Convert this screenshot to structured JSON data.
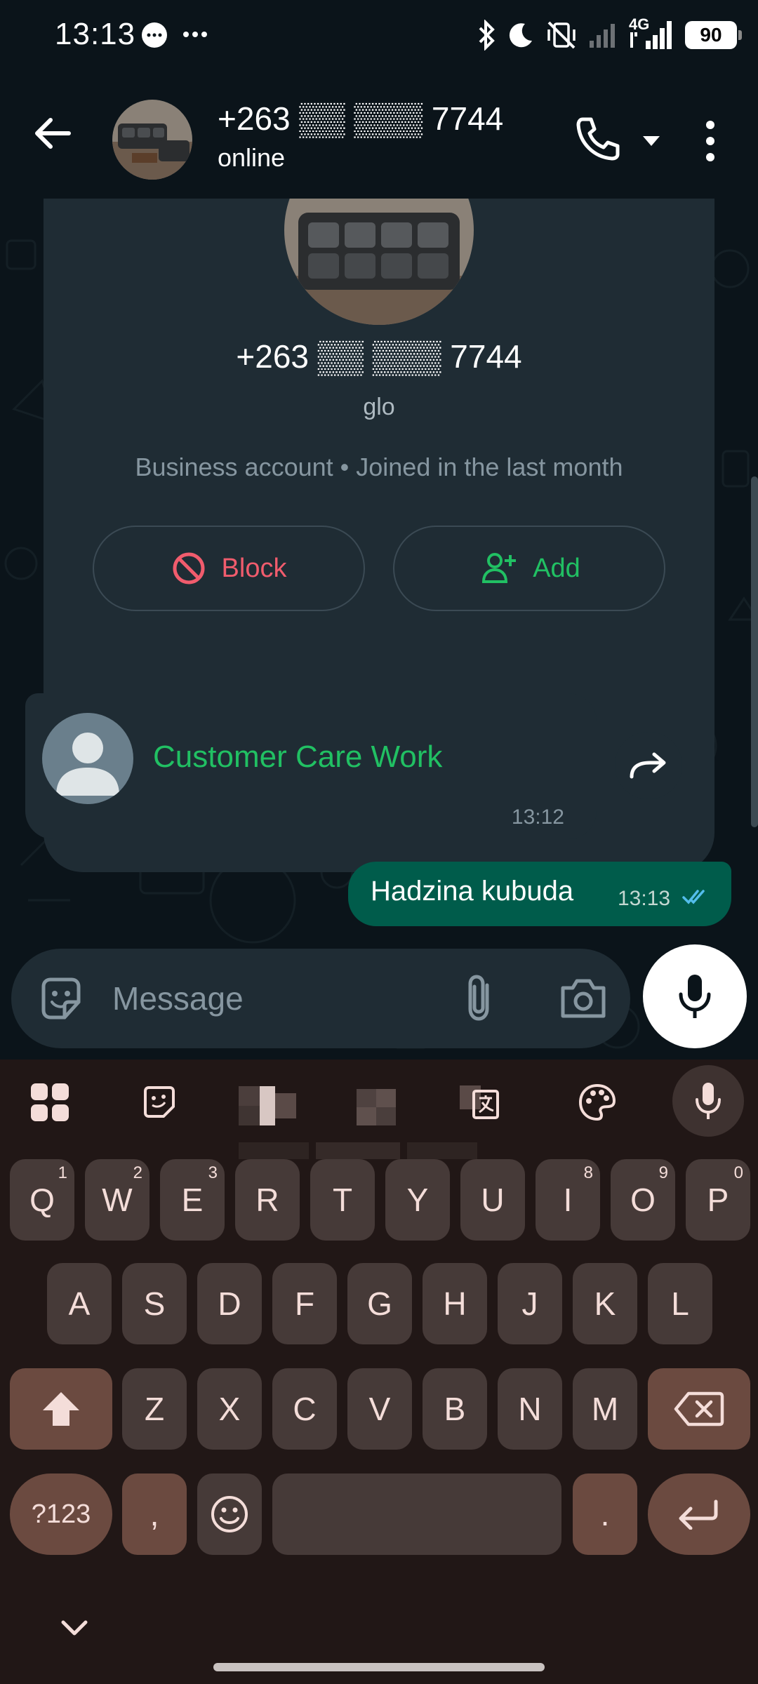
{
  "status_bar": {
    "time": "13:13",
    "icons": [
      "message-bubble-icon",
      "more-dots-icon",
      "bluetooth-icon",
      "moon-icon",
      "vibrate-off-icon",
      "signal-icon",
      "4g-signal-icon"
    ],
    "network": "4G",
    "battery": "90"
  },
  "header": {
    "contact_name": "+263 ▒▒ ▒▒▒ 7744",
    "status": "online"
  },
  "profile_card": {
    "number": "+263 ▒▒ ▒▒▒ 7744",
    "subtitle": "glo",
    "info": "Business account  •  Joined in the last month",
    "block_label": "Block",
    "add_label": "Add"
  },
  "messages": [
    {
      "type": "contact",
      "direction": "incoming",
      "name": "Customer Care Work",
      "time": "13:12"
    },
    {
      "type": "text",
      "direction": "outgoing",
      "text": "Hadzina kubuda",
      "time": "13:13",
      "status": "read"
    }
  ],
  "composer": {
    "placeholder": "Message"
  },
  "keyboard": {
    "row1": [
      {
        "k": "Q",
        "h": "1"
      },
      {
        "k": "W",
        "h": "2"
      },
      {
        "k": "E",
        "h": "3"
      },
      {
        "k": "R",
        "h": ""
      },
      {
        "k": "T",
        "h": ""
      },
      {
        "k": "Y",
        "h": ""
      },
      {
        "k": "U",
        "h": ""
      },
      {
        "k": "I",
        "h": "8"
      },
      {
        "k": "O",
        "h": "9"
      },
      {
        "k": "P",
        "h": "0"
      }
    ],
    "row2": [
      "A",
      "S",
      "D",
      "F",
      "G",
      "H",
      "J",
      "K",
      "L"
    ],
    "row3": [
      "Z",
      "X",
      "C",
      "V",
      "B",
      "N",
      "M"
    ],
    "symbols_label": "?123",
    "comma": ",",
    "period": "."
  },
  "colors": {
    "accent_green": "#21c063",
    "outgoing_bubble": "#005c4b",
    "block_red": "#f15c6d",
    "read_ticks": "#53bdeb"
  }
}
